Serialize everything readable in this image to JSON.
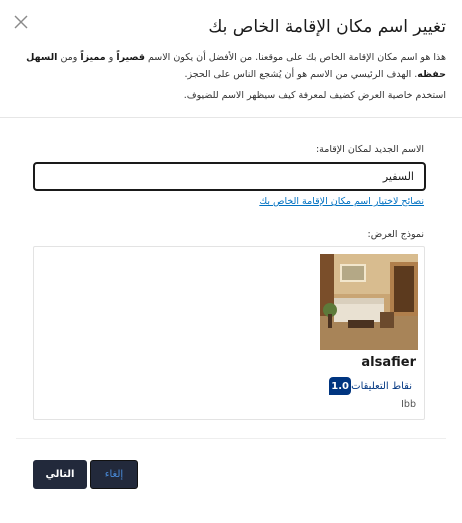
{
  "dialog": {
    "title": "تغيير اسم مكان الإقامة الخاص بك",
    "intro_part1": "هذا هو اسم مكان الإقامة الخاص بك على موقعنا. من الأفضل أن يكون الاسم ",
    "intro_bold1": "قصيراً",
    "intro_part2": " و ",
    "intro_bold2": "مميزاً",
    "intro_part3": " ومن ",
    "intro_bold3": "السهل حفظه",
    "intro_part4": ". الهدف الرئيسي من الاسم هو أن يُشجع الناس على الحجز.",
    "intro_line2": "استخدم خاصية العرض كضيف لمعرفة كيف سيظهر الاسم للضيوف."
  },
  "form": {
    "field_label": "الاسم الجديد لمكان الإقامة:",
    "name_value": "السفير",
    "tips_link": "نصائح لاختيار اسم مكان الإقامة الخاص بك"
  },
  "preview": {
    "label": "نموذج العرض:",
    "property_name": "alsafier",
    "score": "1.0",
    "score_label": "نقاط التعليقات",
    "location": "Ibb"
  },
  "footer": {
    "next_label": "التالي",
    "cancel_label": "إلغاء"
  },
  "colors": {
    "brand_blue": "#003580",
    "link_blue": "#0071c2",
    "button_dark": "#22293b"
  },
  "icons": {
    "close": "close-icon"
  }
}
